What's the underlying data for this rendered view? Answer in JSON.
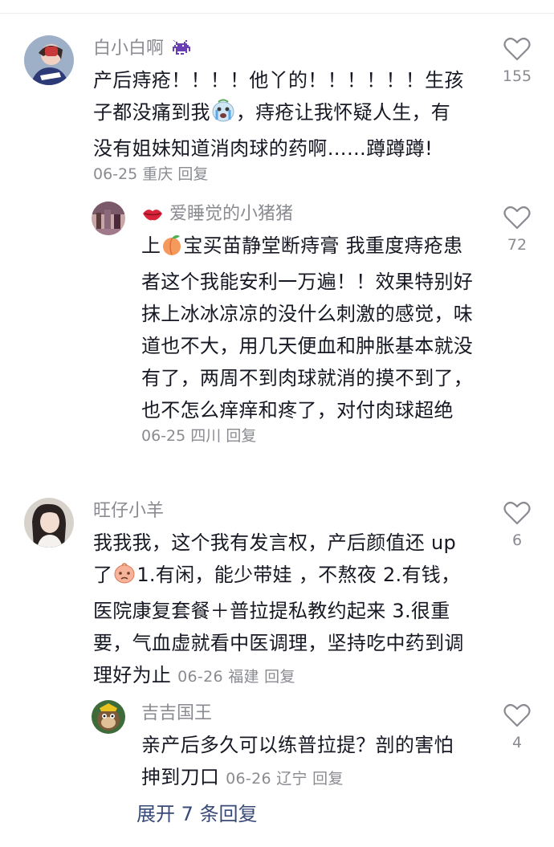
{
  "comments": [
    {
      "username": "白小白啊",
      "lines": [
        "产后痔疮！！！！他丫的！！！！！！生孩",
        "子都没痛到我",
        "，痔疮让我怀疑人生，有",
        "没有姐妹知道消肉球的药啊……蹲蹲蹲!"
      ],
      "date": "06-25",
      "location": "重庆",
      "reply_label": "回复",
      "likes": "155"
    },
    {
      "username": "爱睡觉的小猪猪",
      "lines": [
        "上",
        "宝买苗静堂断痔膏 我重度痔疮患",
        "者这个我能安利一万遍！！效果特别好",
        "抹上冰冰凉凉的没什么刺激的感觉，味",
        "道也不大，用几天便血和肿胀基本就没",
        "有了，两周不到肉球就消的摸不到了，",
        "也不怎么痒痒和疼了，对付肉球超绝"
      ],
      "date": "06-25",
      "location": "四川",
      "reply_label": "回复",
      "likes": "72"
    },
    {
      "username": "旺仔小羊",
      "lines": [
        "我我我，这个我有发言权，产后颜值还 up",
        "了",
        "1.有闲，能少带娃 ，不熬夜 2.有钱，",
        "医院康复套餐＋普拉提私教约起来 3.很重",
        "要，气血虚就看中医调理，坚持吃中药到调",
        "理好为止"
      ],
      "date": "06-26",
      "location": "福建",
      "reply_label": "回复",
      "likes": "6"
    },
    {
      "username": "吉吉国王",
      "lines": [
        "亲产后多久可以练普拉提？剖的害怕",
        "抻到刀口"
      ],
      "date": "06-26",
      "location": "辽宁",
      "reply_label": "回复",
      "likes": "4"
    }
  ],
  "expand_replies": "展开 7 条回复",
  "icons": {
    "like": "heart-outline-icon",
    "badge1": "pixel-invader-icon",
    "badge2": "lips-icon",
    "emoji1": "crying-face-icon",
    "emoji2": "peach-icon",
    "emoji3": "sad-face-icon"
  }
}
